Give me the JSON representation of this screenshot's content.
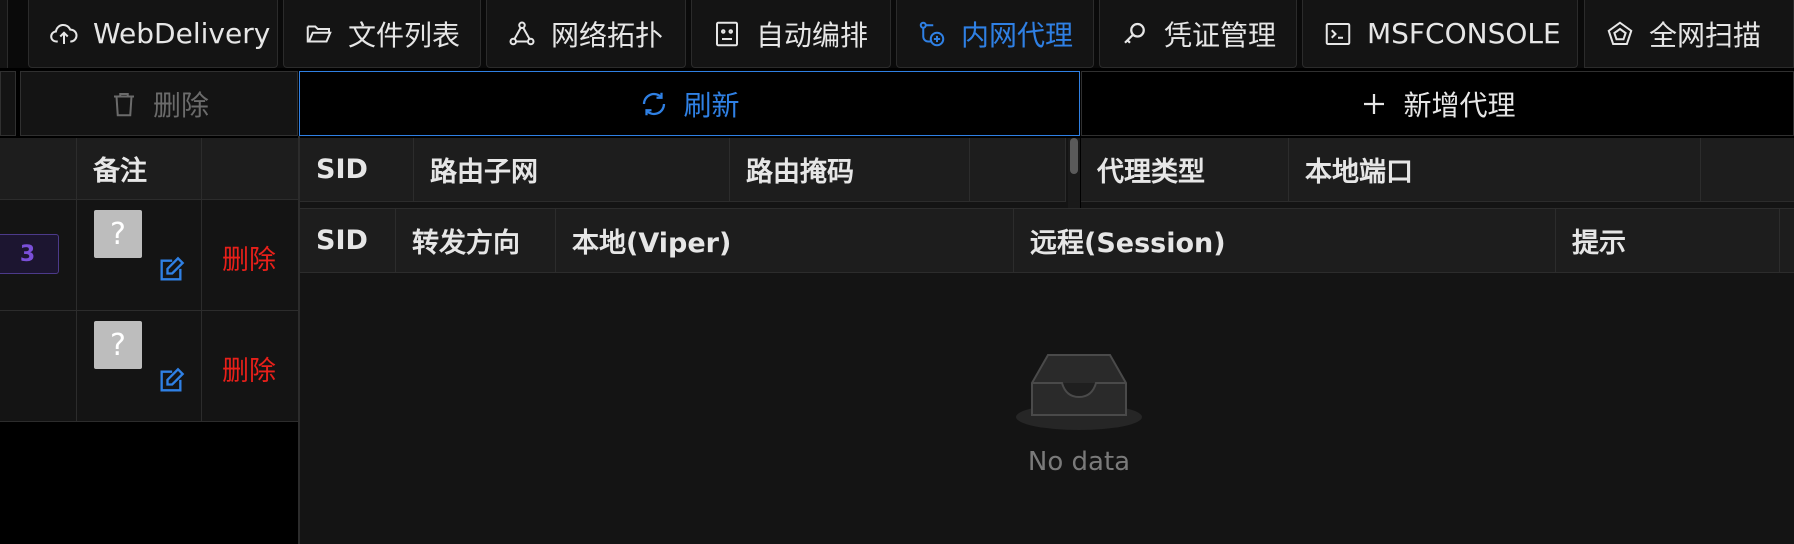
{
  "tabs": [
    {
      "label": "WebDelivery",
      "icon": "cloud-upload-icon",
      "active": false
    },
    {
      "label": "文件列表",
      "icon": "folder-open-icon",
      "active": false
    },
    {
      "label": "网络拓扑",
      "icon": "network-topology-icon",
      "active": false
    },
    {
      "label": "自动编排",
      "icon": "robot-icon",
      "active": false
    },
    {
      "label": "内网代理",
      "icon": "proxy-node-icon",
      "active": true
    },
    {
      "label": "凭证管理",
      "icon": "key-icon",
      "active": false
    },
    {
      "label": "MSFCONSOLE",
      "icon": "terminal-icon",
      "active": false
    },
    {
      "label": "全网扫描",
      "icon": "radar-scan-icon",
      "active": false
    }
  ],
  "toolbar": {
    "delete_label": "删除",
    "refresh_label": "刷新",
    "add_proxy_label": "新增代理"
  },
  "left_table": {
    "header_note": "备注",
    "rows": [
      {
        "badge": "3",
        "note": "?",
        "delete_label": "删除"
      },
      {
        "badge": "",
        "note": "?",
        "delete_label": "删除"
      }
    ]
  },
  "route_table": {
    "headers": [
      "SID",
      "路由子网",
      "路由掩码",
      ""
    ]
  },
  "proxy_table": {
    "headers": [
      "代理类型",
      "本地端口",
      ""
    ]
  },
  "portfwd_table": {
    "headers": [
      "SID",
      "转发方向",
      "本地(Viper)",
      "远程(Session)",
      "提示"
    ],
    "empty_text": "No data"
  },
  "colors": {
    "accent": "#2f80e4",
    "danger": "#e8201a",
    "badge": "#7a4fd8",
    "background": "#000000"
  }
}
